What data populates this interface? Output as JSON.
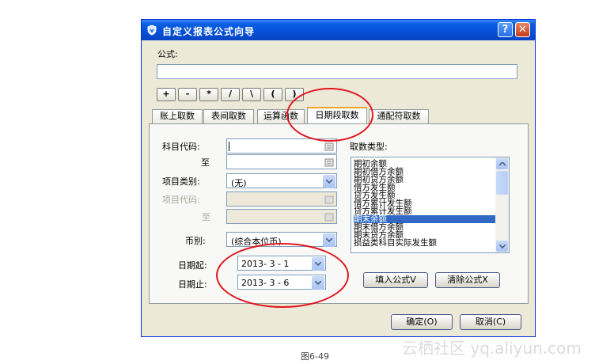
{
  "dialog": {
    "title": "自定义报表公式向导",
    "help_button": "?",
    "close_button": "✕",
    "formula_label": "公式:",
    "formula_value": "",
    "operators": [
      "+",
      "-",
      "*",
      "/",
      "\\",
      "(",
      ")"
    ],
    "tabs": [
      "账上取数",
      "表间取数",
      "运算函数",
      "日期段取数",
      "通配符取数"
    ],
    "active_tab": 3,
    "fields": {
      "subject_code_label": "科目代码:",
      "to_label": "至",
      "item_category_label": "项目类别:",
      "item_category_value": "(无)",
      "item_code_label": "项目代码:",
      "to2_label": "至",
      "currency_label": "币别:",
      "currency_value": "(综合本位币)",
      "date_start_label": "日期起:",
      "date_start_value": "2013- 3 - 1",
      "date_end_label": "日期止:",
      "date_end_value": "2013- 3 - 6"
    },
    "fetch_type_label": "取数类型:",
    "fetch_types": [
      "期初余额",
      "期初借方余额",
      "期初贷方余额",
      "借方发生额",
      "贷方发生额",
      "借方累计发生额",
      "贷方累计发生额",
      "期末余额",
      "期末借方余额",
      "期末贷方余额",
      "损益类科目实际发生额"
    ],
    "selected_fetch_type": 7,
    "fill_formula_button": "填入公式V",
    "clear_formula_button": "清除公式X",
    "ok_button": "确定(O)",
    "cancel_button": "取消(C)"
  },
  "caption": "图6-49",
  "watermark": "云栖社区 yq.aliyun.com",
  "colors": {
    "titlebar": "#0550d8",
    "annotation": "#e0161e",
    "selection": "#316ac5"
  }
}
